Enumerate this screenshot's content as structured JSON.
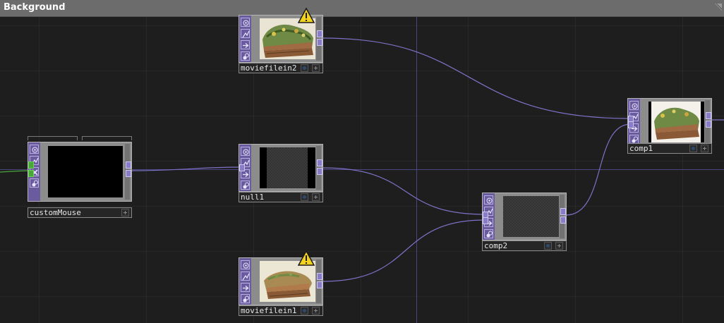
{
  "window": {
    "title": "Background"
  },
  "wire_color": "#7e72c8",
  "nodes": {
    "moviefilein2": {
      "name": "moviefilein2",
      "warning_icon": "warning-triangle-icon"
    },
    "custommouse": {
      "name": "customMouse"
    },
    "null1": {
      "name": "null1"
    },
    "moviefilein1": {
      "name": "moviefilein1",
      "warning_icon": "warning-triangle-icon"
    },
    "comp2": {
      "name": "comp2"
    },
    "comp1": {
      "name": "comp1"
    }
  },
  "node_icons": [
    "viewer-icon",
    "wire-icon",
    "arrow-right-icon",
    "bypass-icon"
  ],
  "custommouse_icons": [
    "viewer-icon",
    "wire-icon",
    "close-icon",
    "bypass-icon"
  ]
}
